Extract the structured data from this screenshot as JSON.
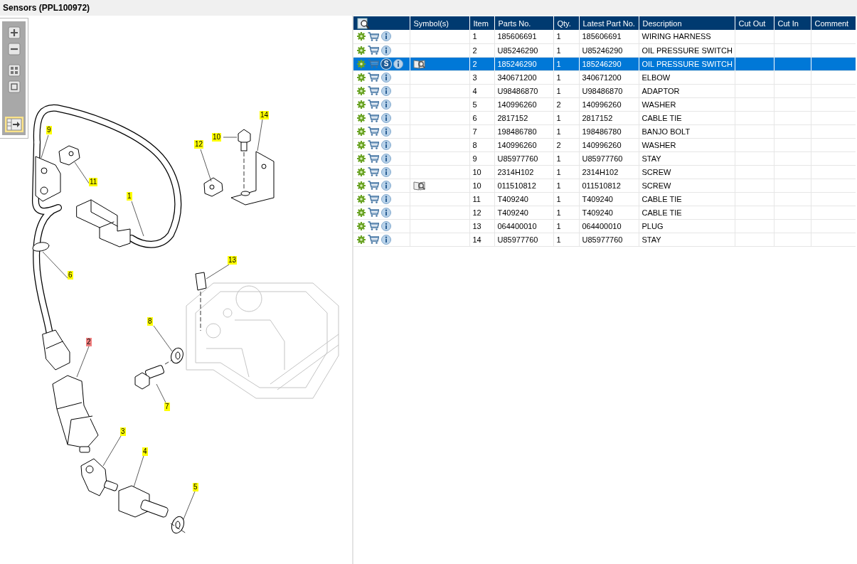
{
  "title": "Sensors (PPL100972)",
  "toolbar": [
    {
      "kind": "zoom_in",
      "on": false
    },
    {
      "kind": "zoom_out",
      "on": false
    },
    {
      "kind": "fit_all",
      "on": false
    },
    {
      "kind": "actual_size",
      "on": false
    },
    {
      "kind": "list_view",
      "on": true
    }
  ],
  "callouts": [
    {
      "label": "9",
      "selected": false
    },
    {
      "label": "11",
      "selected": false
    },
    {
      "label": "1",
      "selected": false
    },
    {
      "label": "6",
      "selected": false
    },
    {
      "label": "12",
      "selected": false
    },
    {
      "label": "10",
      "selected": false
    },
    {
      "label": "14",
      "selected": false
    },
    {
      "label": "13",
      "selected": false
    },
    {
      "label": "8",
      "selected": false
    },
    {
      "label": "2",
      "selected": true
    },
    {
      "label": "7",
      "selected": false
    },
    {
      "label": "3",
      "selected": false
    },
    {
      "label": "4",
      "selected": false
    },
    {
      "label": "5",
      "selected": false
    }
  ],
  "table": {
    "columns": [
      "Symbol(s)",
      "Item",
      "Parts No.",
      "Qty.",
      "Latest Part No.",
      "Description",
      "Cut Out",
      "Cut In",
      "Comment"
    ],
    "rows": [
      {
        "item": "1",
        "parts_no": "185606691",
        "qty": "1",
        "latest_part_no": "185606691",
        "description": "WIRING HARNESS",
        "selected": false,
        "symbol": false
      },
      {
        "item": "2",
        "parts_no": "U85246290",
        "qty": "1",
        "latest_part_no": "U85246290",
        "description": "OIL PRESSURE SWITCH",
        "selected": false,
        "symbol": false
      },
      {
        "item": "2",
        "parts_no": "185246290",
        "qty": "1",
        "latest_part_no": "185246290",
        "description": "OIL PRESSURE SWITCH",
        "selected": true,
        "symbol": true,
        "badge": "S"
      },
      {
        "item": "3",
        "parts_no": "340671200",
        "qty": "1",
        "latest_part_no": "340671200",
        "description": "ELBOW",
        "selected": false,
        "symbol": false
      },
      {
        "item": "4",
        "parts_no": "U98486870",
        "qty": "1",
        "latest_part_no": "U98486870",
        "description": "ADAPTOR",
        "selected": false,
        "symbol": false
      },
      {
        "item": "5",
        "parts_no": "140996260",
        "qty": "2",
        "latest_part_no": "140996260",
        "description": "WASHER",
        "selected": false,
        "symbol": false
      },
      {
        "item": "6",
        "parts_no": "2817152",
        "qty": "1",
        "latest_part_no": "2817152",
        "description": "CABLE TIE",
        "selected": false,
        "symbol": false
      },
      {
        "item": "7",
        "parts_no": "198486780",
        "qty": "1",
        "latest_part_no": "198486780",
        "description": "BANJO BOLT",
        "selected": false,
        "symbol": false
      },
      {
        "item": "8",
        "parts_no": "140996260",
        "qty": "2",
        "latest_part_no": "140996260",
        "description": "WASHER",
        "selected": false,
        "symbol": false
      },
      {
        "item": "9",
        "parts_no": "U85977760",
        "qty": "1",
        "latest_part_no": "U85977760",
        "description": "STAY",
        "selected": false,
        "symbol": false
      },
      {
        "item": "10",
        "parts_no": "2314H102",
        "qty": "1",
        "latest_part_no": "2314H102",
        "description": "SCREW",
        "selected": false,
        "symbol": false
      },
      {
        "item": "10",
        "parts_no": "011510812",
        "qty": "1",
        "latest_part_no": "011510812",
        "description": "SCREW",
        "selected": false,
        "symbol": true
      },
      {
        "item": "11",
        "parts_no": "T409240",
        "qty": "1",
        "latest_part_no": "T409240",
        "description": "CABLE TIE",
        "selected": false,
        "symbol": false
      },
      {
        "item": "12",
        "parts_no": "T409240",
        "qty": "1",
        "latest_part_no": "T409240",
        "description": "CABLE TIE",
        "selected": false,
        "symbol": false
      },
      {
        "item": "13",
        "parts_no": "064400010",
        "qty": "1",
        "latest_part_no": "064400010",
        "description": "PLUG",
        "selected": false,
        "symbol": false
      },
      {
        "item": "14",
        "parts_no": "U85977760",
        "qty": "1",
        "latest_part_no": "U85977760",
        "description": "STAY",
        "selected": false,
        "symbol": false
      }
    ]
  }
}
